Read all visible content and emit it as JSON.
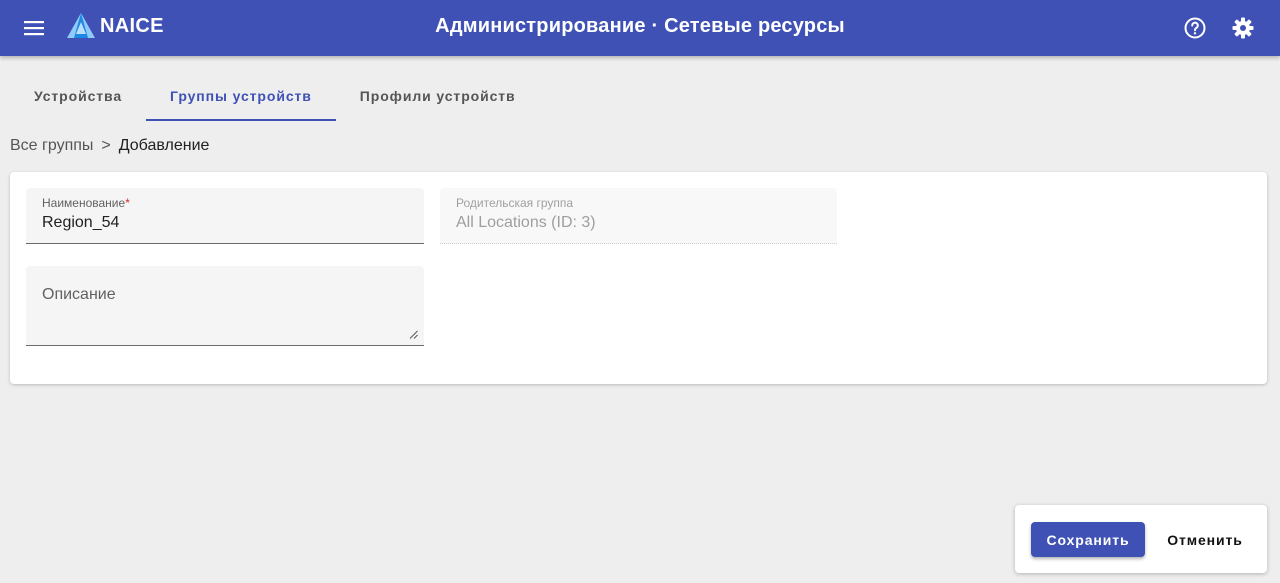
{
  "colors": {
    "primary": "#3f51b5",
    "background": "#eeeeee",
    "card": "#ffffff",
    "required": "#d32f2f"
  },
  "header": {
    "brand": "NAICE",
    "title": "Администрирование · Сетевые ресурсы",
    "icons": [
      "menu-icon",
      "logo-icon",
      "help-icon",
      "settings-icon"
    ]
  },
  "tabs": [
    {
      "label": "Устройства",
      "active": false
    },
    {
      "label": "Группы устройств",
      "active": true
    },
    {
      "label": "Профили устройств",
      "active": false
    }
  ],
  "breadcrumb": {
    "link": "Все группы",
    "separator": ">",
    "current": "Добавление"
  },
  "form": {
    "name": {
      "label": "Наименование",
      "required_mark": "*",
      "value": "Region_54"
    },
    "parent": {
      "label": "Родительская группа",
      "value": "All Locations (ID: 3)"
    },
    "description": {
      "placeholder": "Описание",
      "value": ""
    }
  },
  "actions": {
    "save_label": "Сохранить",
    "cancel_label": "Отменить"
  }
}
